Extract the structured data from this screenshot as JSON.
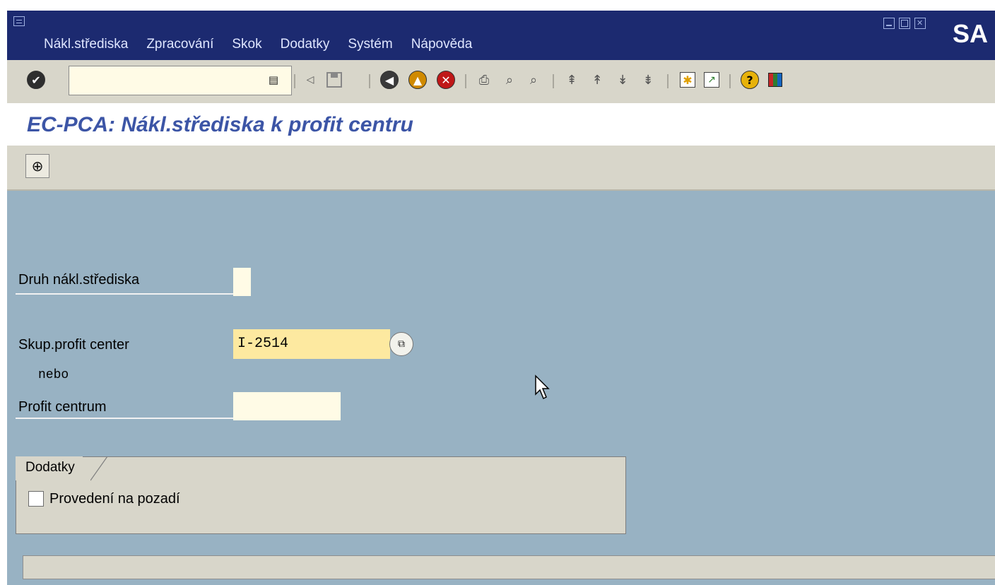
{
  "menu": {
    "items": [
      {
        "label": "Nákl.střediska"
      },
      {
        "label": "Zpracování"
      },
      {
        "label": "Skok"
      },
      {
        "label": "Dodatky"
      },
      {
        "label": "Systém"
      },
      {
        "label": "Nápověda"
      }
    ]
  },
  "brand": {
    "logo_text": "SA"
  },
  "command_field": {
    "value": ""
  },
  "screen": {
    "title": "EC-PCA: Nákl.střediska k profit centru"
  },
  "form": {
    "cost_center_type": {
      "label": "Druh nákl.střediska",
      "value": ""
    },
    "profit_center_group": {
      "label": "Skup.profit center",
      "value": "I-2514"
    },
    "or_text": "nebo",
    "profit_center": {
      "label": "Profit centrum",
      "value": ""
    }
  },
  "extras": {
    "tab_label": "Dodatky",
    "background_label": "Provedení na pozadí",
    "background_checked": false
  },
  "status_bar": {
    "text": ""
  },
  "colors": {
    "title_bar": "#1c2a70",
    "toolbar": "#d8d6ca",
    "screen_bg": "#98b2c3",
    "heading_text": "#3c55a6",
    "required_field": "#fde9a0",
    "input_field": "#fffbe6"
  },
  "icons": {
    "enter": "enter-icon",
    "save": "save-icon",
    "back": "back-icon",
    "exit": "exit-icon",
    "cancel": "cancel-icon",
    "print": "print-icon",
    "find": "find-icon",
    "find_next": "find-next-icon",
    "first_page": "first-page-icon",
    "prev_page": "prev-page-icon",
    "next_page": "next-page-icon",
    "last_page": "last-page-icon",
    "new_session": "new-session-icon",
    "shortcut": "shortcut-icon",
    "help": "help-icon",
    "layout": "layout-icon",
    "execute": "execute-icon",
    "multiple_selection": "multiple-selection-icon"
  }
}
